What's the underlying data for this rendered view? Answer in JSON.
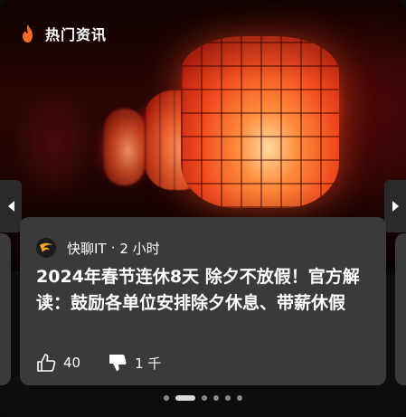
{
  "header": {
    "title": "热门资讯",
    "icon": "flame-icon",
    "accent": "#f26a2e"
  },
  "article": {
    "source": "快聊IT",
    "separator": "·",
    "time": "2 小时",
    "headline": "2024年春节连休8天 除夕不放假！官方解读：鼓励各单位安排除夕休息、带薪休假",
    "likes": "40",
    "dislikes": "1 千"
  },
  "carousel": {
    "slide_count": 6,
    "active_index": 1
  },
  "colors": {
    "card_bg": "#3a3a3a",
    "page_bg": "#0d0d0d",
    "dot": "#8a8a8a",
    "dot_active": "#d9d9d9"
  }
}
